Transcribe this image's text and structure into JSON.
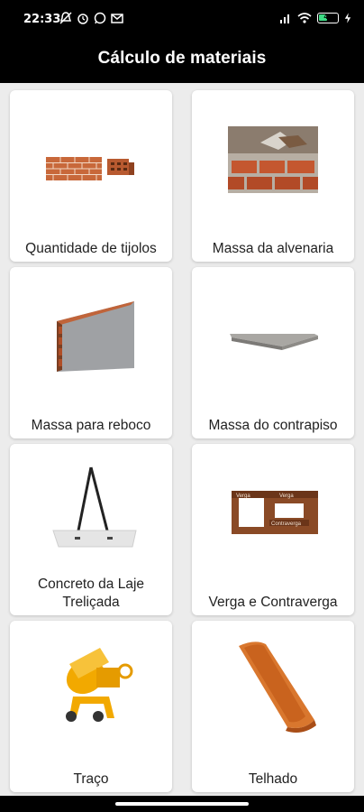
{
  "status": {
    "time": "22:33",
    "battery": "40"
  },
  "app": {
    "title": "Cálculo de materiais"
  },
  "cards": [
    {
      "label": "Quantidade de tijolos",
      "icon": "bricks-icon"
    },
    {
      "label": "Massa da alvenaria",
      "icon": "masonry-wall-icon"
    },
    {
      "label": "Massa para reboco",
      "icon": "plaster-wall-icon"
    },
    {
      "label": "Massa do contrapiso",
      "icon": "floor-slab-icon"
    },
    {
      "label": "Concreto da Laje Treliçada",
      "icon": "lattice-slab-icon"
    },
    {
      "label": "Verga e Contraverga",
      "icon": "lintel-icon"
    },
    {
      "label": "Traço",
      "icon": "concrete-mixer-icon"
    },
    {
      "label": "Telhado",
      "icon": "roof-tile-icon"
    }
  ],
  "lintel_diagram": {
    "top_left": "Verga",
    "top_right": "Verga",
    "bottom": "Contraverga"
  },
  "colors": {
    "bar": "#000000",
    "background": "#ececec",
    "card": "#ffffff",
    "brick": "#c8683a",
    "mixer": "#f2a900",
    "tile": "#d9772e"
  }
}
